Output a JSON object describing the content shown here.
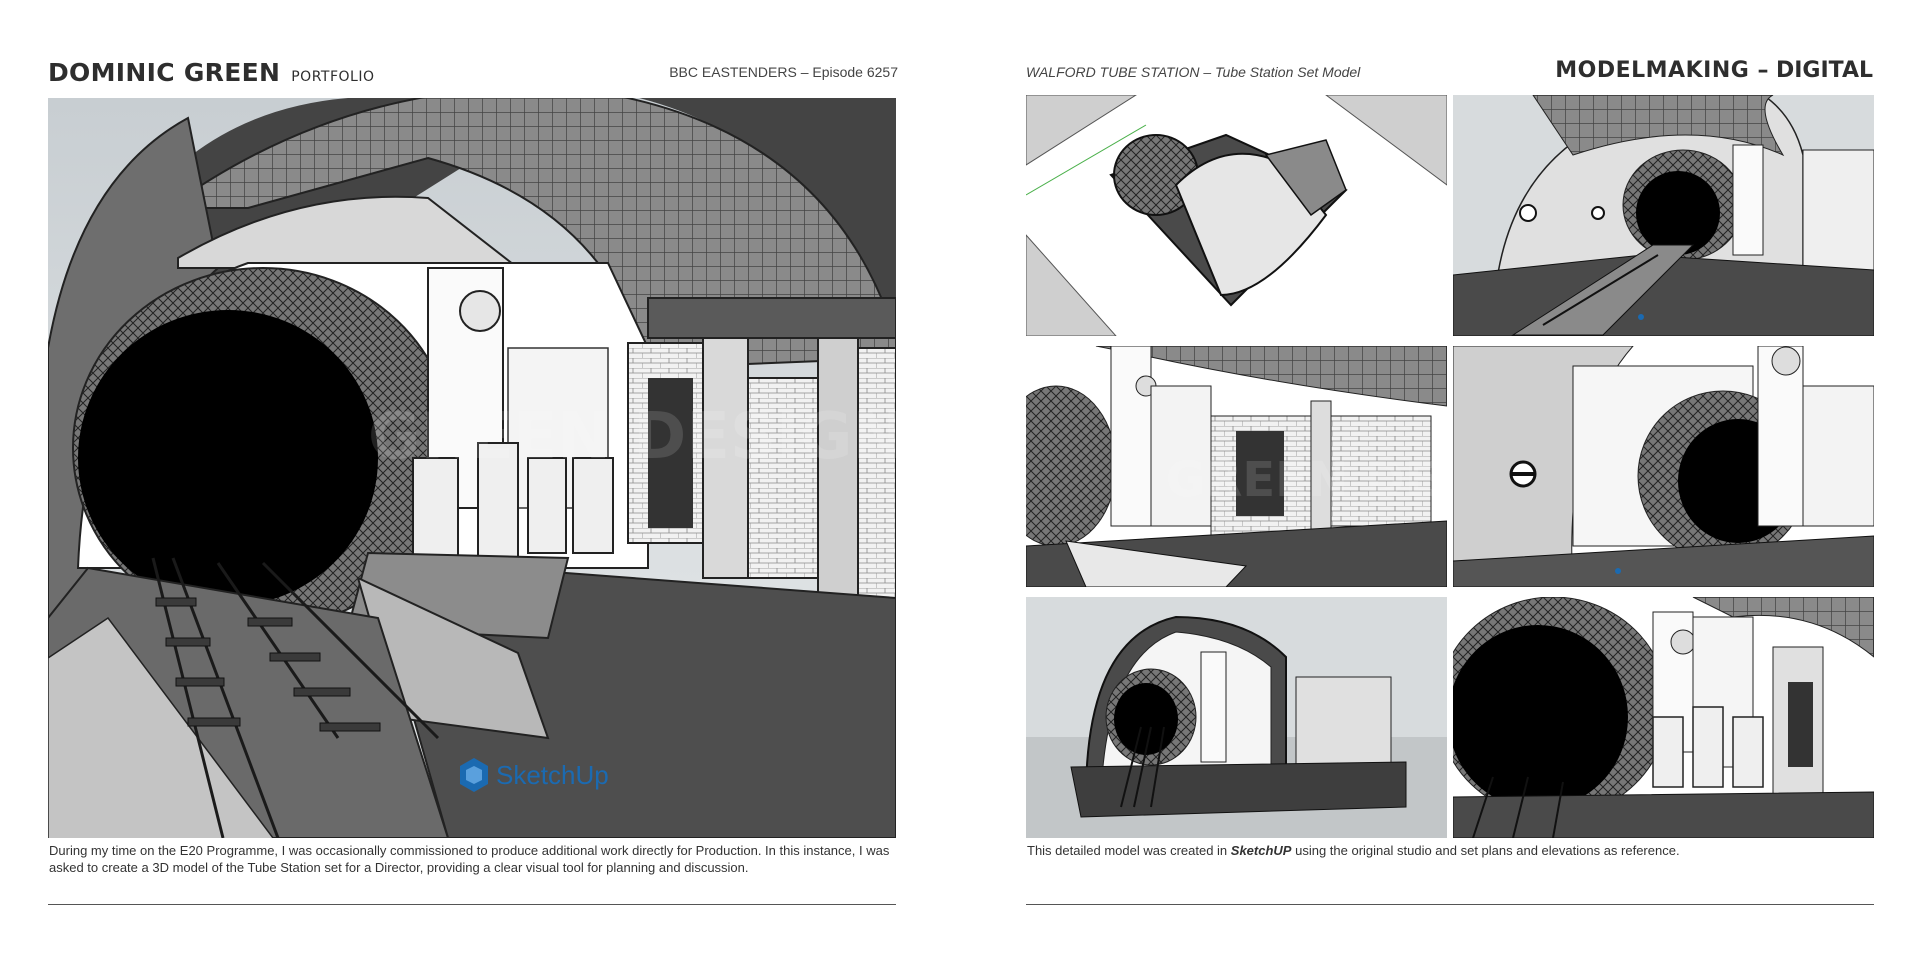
{
  "header": {
    "name": "DOMINIC GREEN",
    "portfolio": "PORTFOLIO",
    "episode": "BBC EASTENDERS – Episode 6257",
    "project": "WALFORD TUBE STATION –  Tube Station Set Model",
    "section_a": "MODELMAKING –",
    "section_b": "DIGITAL"
  },
  "main_image": {
    "logo_text": "SketchUp",
    "watermark": "GREEN DESIGN"
  },
  "captions": {
    "left": "During my time on the E20 Programme, I was occasionally commissioned to produce additional work directly for Production. In this instance, I was asked to create a 3D model of the Tube Station set for a Director, providing a clear visual tool for planning and discussion.",
    "right_pre": "This detailed model was created in ",
    "right_bold": "SketchUP",
    "right_post": " using the original studio and set plans and elevations as reference."
  },
  "thumbnails": [
    {
      "view": "top-down overview"
    },
    {
      "view": "platform perspective with roundels"
    },
    {
      "view": "booth and wall elevation"
    },
    {
      "view": "tunnel mouth with roundel"
    },
    {
      "view": "cutaway section"
    },
    {
      "view": "close tunnel view"
    }
  ]
}
